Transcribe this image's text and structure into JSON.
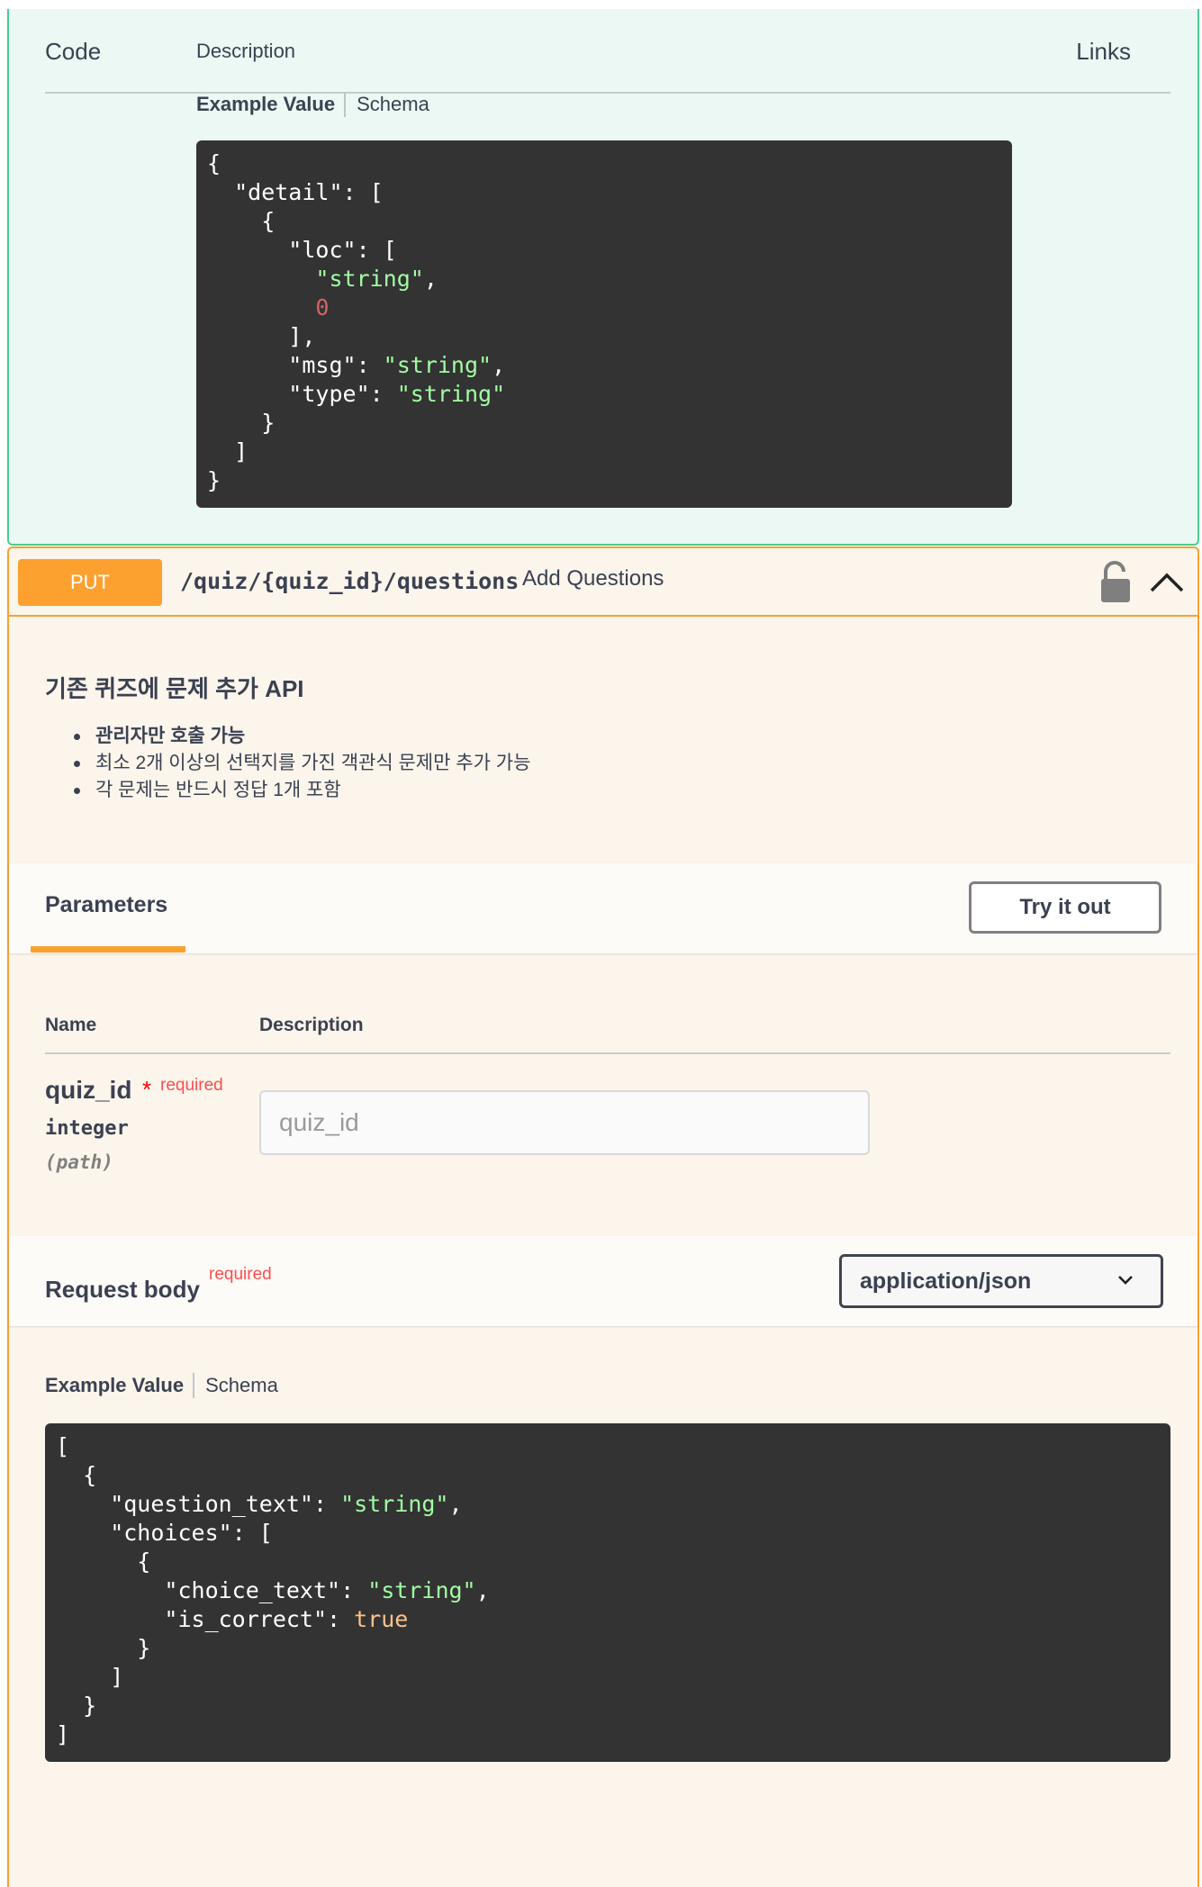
{
  "responses": {
    "col_code": "Code",
    "col_description": "Description",
    "col_links": "Links",
    "example_tab": "Example Value",
    "schema_tab": "Schema"
  },
  "operation": {
    "method": "PUT",
    "path": "/quiz/{quiz_id}/questions",
    "summary": "Add Questions",
    "description_title": "기존 퀴즈에 문제 추가 API",
    "description_items": [
      "관리자만 호출 가능",
      "최소 2개 이상의 선택지를 가진 객관식 문제만 추가 가능",
      "각 문제는 반드시 정답 1개 포함"
    ],
    "icons": {
      "lock": "unlocked-lock-icon",
      "collapse": "chevron-up-icon"
    }
  },
  "parameters": {
    "title": "Parameters",
    "try_button": "Try it out",
    "col_name": "Name",
    "col_description": "Description",
    "items": [
      {
        "name": "quiz_id",
        "star": "*",
        "required": "required",
        "type": "integer",
        "in": "(path)",
        "placeholder": "quiz_id"
      }
    ]
  },
  "request_body": {
    "title": "Request body",
    "required": "required",
    "content_type": "application/json",
    "example_tab": "Example Value",
    "schema_tab": "Schema"
  },
  "colors": {
    "put_accent": "#fca130",
    "put_background": "#fcf5ec",
    "post_accent": "#49cc90",
    "post_background": "#ebf8f4",
    "code_background": "#333333"
  }
}
